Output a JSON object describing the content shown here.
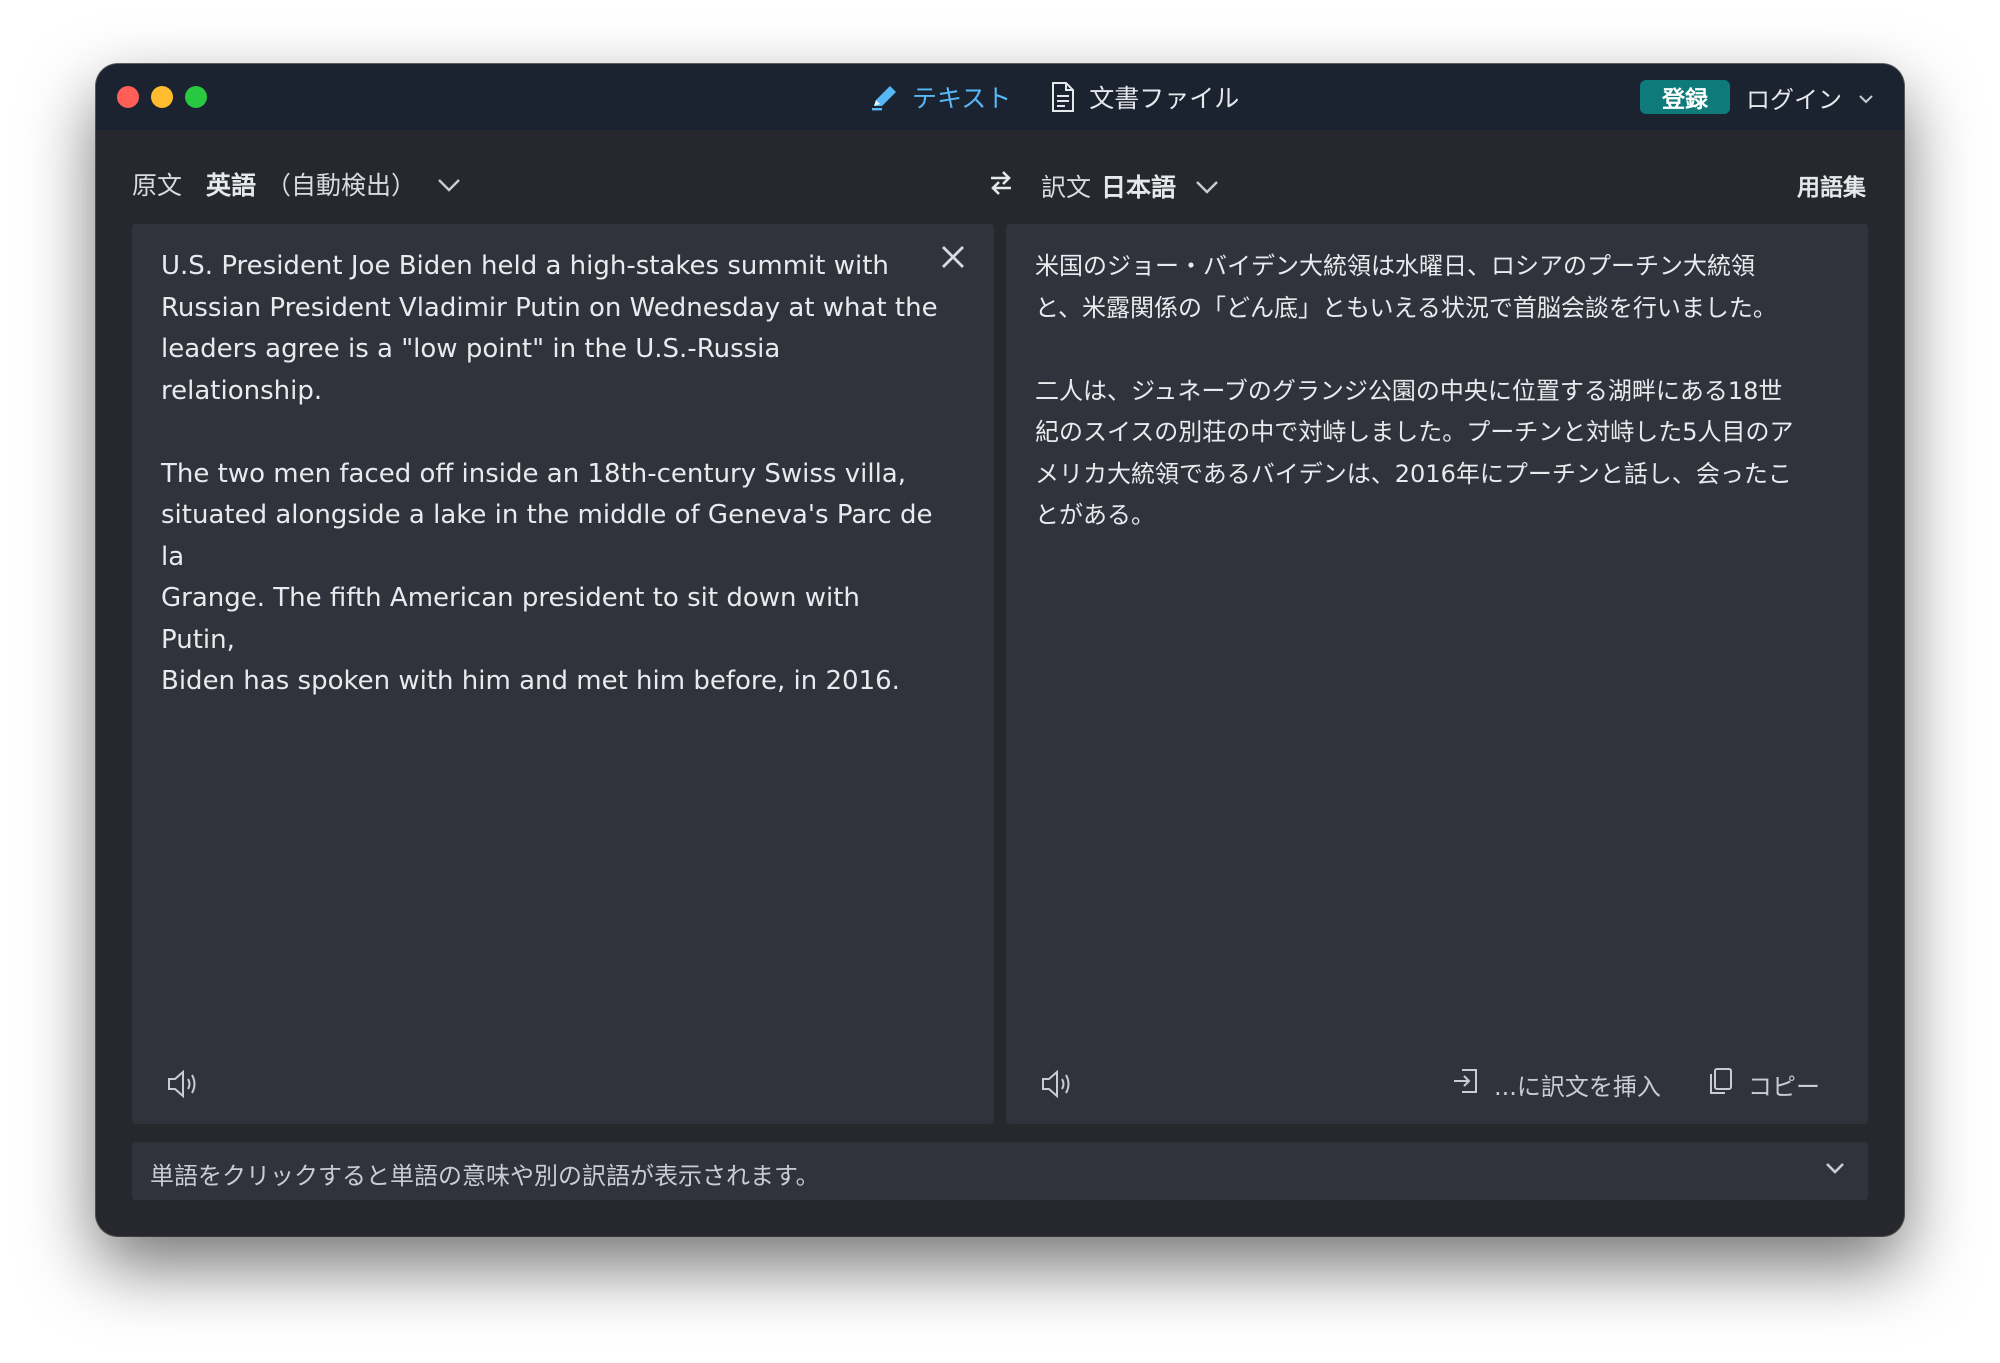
{
  "titlebar": {
    "modes": [
      {
        "label": "テキスト",
        "icon": "pen-icon",
        "active": true
      },
      {
        "label": "文書ファイル",
        "icon": "document-icon",
        "active": false
      }
    ],
    "register_label": "登録",
    "login_label": "ログイン"
  },
  "source": {
    "label": "原文",
    "language": "英語",
    "auto_detect": "（自動検出）",
    "text": "U.S. President Joe Biden held a high-stakes summit with\nRussian President Vladimir Putin on Wednesday at what the\nleaders agree is a \"low point\" in the U.S.-Russia relationship.\n\nThe two men faced off inside an 18th-century Swiss villa,\nsituated alongside a lake in the middle of Geneva's Parc de la\nGrange. The fifth American president to sit down with Putin,\nBiden has spoken with him and met him before, in 2016."
  },
  "target": {
    "label": "訳文",
    "language": "日本語",
    "glossary_label": "用語集",
    "text": "米国のジョー・バイデン大統領は水曜日、ロシアのプーチン大統領\nと、米露関係の「どん底」ともいえる状況で首脳会談を行いました。\n\n二人は、ジュネーブのグランジ公園の中央に位置する湖畔にある18世\n紀のスイスの別荘の中で対峙しました。プーチンと対峙した5人目のア\nメリカ大統領であるバイデンは、2016年にプーチンと話し、会ったこ\nとがある。",
    "insert_label": "...に訳文を挿入",
    "copy_label": "コピー"
  },
  "hint": {
    "text": "単語をクリックすると単語の意味や別の訳語が表示されます。"
  },
  "colors": {
    "accent_blue": "#58b8f5",
    "register_teal": "#0f7a7a",
    "window_bg": "#26282d",
    "titlebar_bg": "#1b2330",
    "pane_bg": "#30333b"
  }
}
